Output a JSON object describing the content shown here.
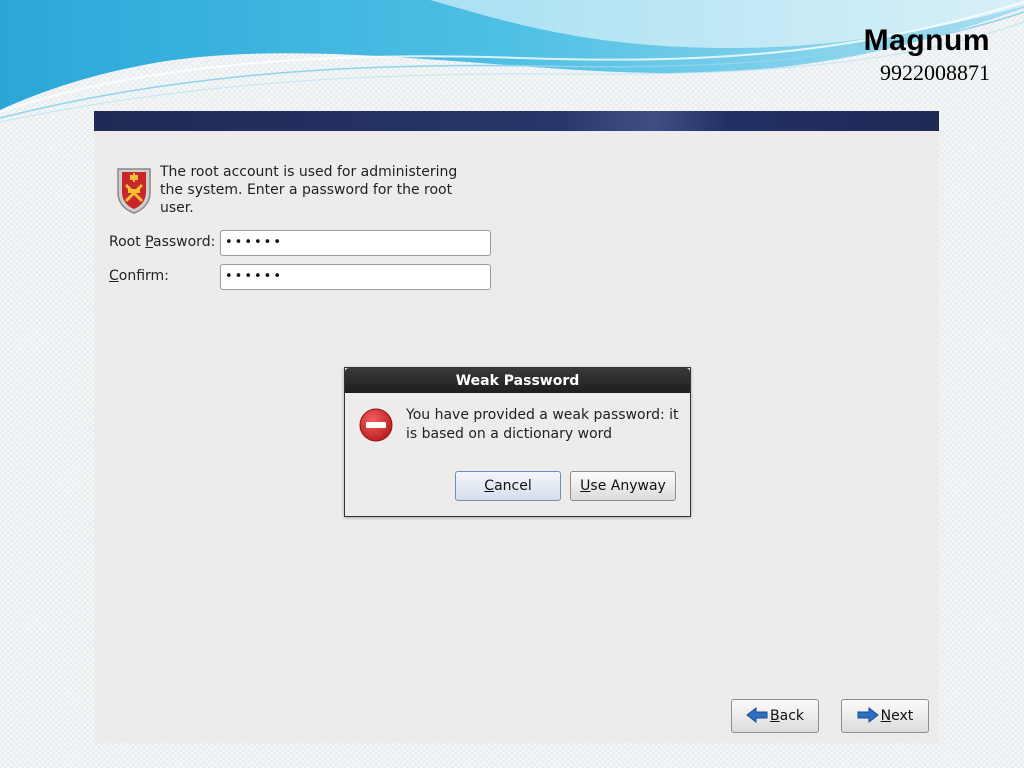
{
  "brand": {
    "name": "Magnum",
    "phone": "9922008871"
  },
  "installer": {
    "intro": "The root account is used for administering the system.  Enter a password for the root user.",
    "root_password_label_mnemonic": "P",
    "root_password_label_pre": "Root ",
    "root_password_label_post": "assword:",
    "root_password_value": "••••••",
    "confirm_label_mnemonic": "C",
    "confirm_label_post": "onfirm:",
    "confirm_value": "••••••",
    "back_mnemonic": "B",
    "back_rest": "ack",
    "next_mnemonic": "N",
    "next_rest": "ext"
  },
  "dialog": {
    "title": "Weak Password",
    "message": "You have provided a weak password: it is based on a dictionary word",
    "cancel_mnemonic": "C",
    "cancel_rest": "ancel",
    "use_mnemonic": "U",
    "use_rest": "se Anyway"
  },
  "icons": {
    "shield": "shield-icon",
    "stop": "stop-icon",
    "back": "arrow-left-icon",
    "next": "arrow-right-icon"
  },
  "colors": {
    "topbar": "#1f2a55",
    "panel_bg": "#edeceb",
    "dialog_title_bg": "#1e1e1e",
    "stop_red": "#d42a2a"
  }
}
